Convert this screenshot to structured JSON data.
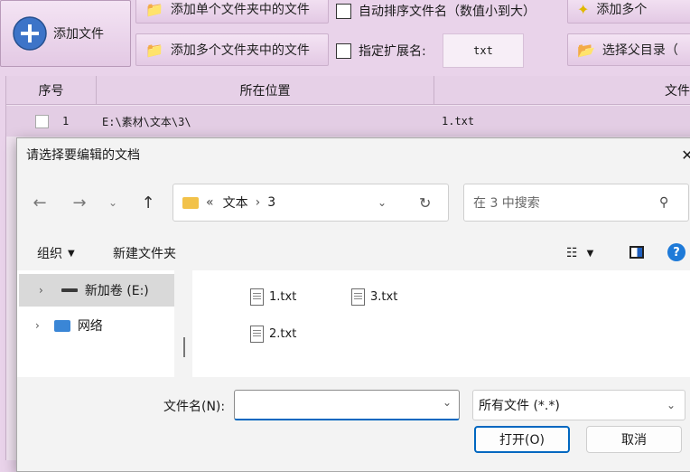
{
  "toolbar": {
    "add_file": "添加文件",
    "add_single_folder": "添加单个文件夹中的文件",
    "add_multi_folder": "添加多个文件夹中的文件",
    "auto_sort": "自动排序文件名（数值小到大）",
    "specify_ext": "指定扩展名:",
    "ext_value": "txt",
    "add_multi_cut": "添加多个",
    "choose_parent": "选择父目录（"
  },
  "table": {
    "headers": [
      "序号",
      "所在位置",
      "文件"
    ],
    "rows": [
      {
        "index": "1",
        "location": "E:\\素材\\文本\\3\\",
        "file": "1.txt"
      }
    ]
  },
  "dialog": {
    "title": "请选择要编辑的文档",
    "close": "✕",
    "breadcrumb": {
      "chevrons": "«",
      "part1": "文本",
      "sep": "›",
      "part2": "3"
    },
    "search_placeholder": "在 3 中搜索",
    "organize": "组织",
    "new_folder": "新建文件夹",
    "tree": [
      {
        "label": "新加卷 (E:)"
      },
      {
        "label": "网络"
      }
    ],
    "files": [
      "1.txt",
      "3.txt",
      "2.txt"
    ],
    "filename_label": "文件名(N):",
    "filename_value": "",
    "filter_value": "所有文件 (*.*)",
    "open_button": "打开(O)",
    "cancel_button": "取消"
  }
}
